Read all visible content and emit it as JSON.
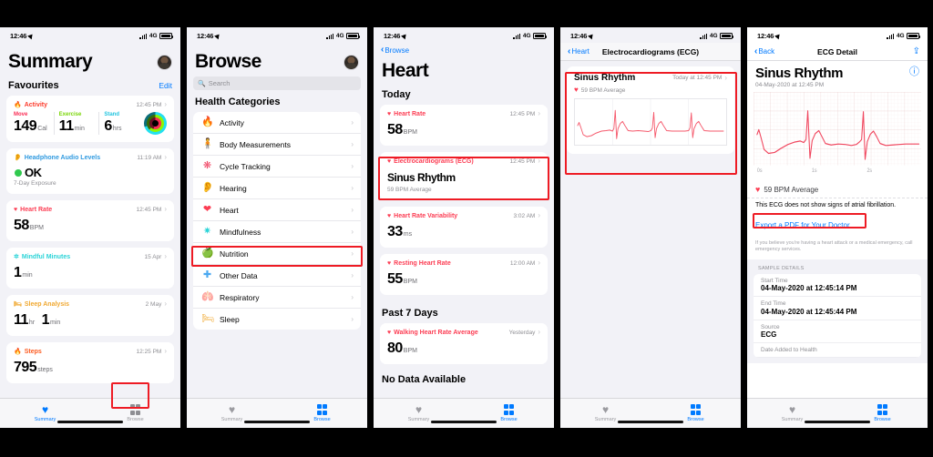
{
  "statusbar": {
    "time": "12:46",
    "network": "4G"
  },
  "panel1": {
    "title": "Summary",
    "section_label": "Favourites",
    "edit_label": "Edit",
    "cards": [
      {
        "name": "Activity",
        "icon": "flame-icon",
        "color": "#fc3c2d",
        "time": "12:45 PM",
        "rings": [
          {
            "label": "Move",
            "value": "149",
            "unit": "Cal",
            "color": "#fa2d55"
          },
          {
            "label": "Exercise",
            "value": "11",
            "unit": "min",
            "color": "#8ef501"
          },
          {
            "label": "Stand",
            "value": "6",
            "unit": "hrs",
            "color": "#22e0f0"
          }
        ]
      },
      {
        "name": "Headphone Audio Levels",
        "icon": "ear-icon",
        "color": "#2f9ae0",
        "time": "11:19 AM",
        "status": "OK",
        "sub": "7-Day Exposure"
      },
      {
        "name": "Heart Rate",
        "icon": "heart-icon",
        "color": "#fc3d53",
        "time": "12:45 PM",
        "value": "58",
        "unit": "BPM"
      },
      {
        "name": "Mindful Minutes",
        "icon": "mindfulness-icon",
        "color": "#2cd4d8",
        "time": "15 Apr",
        "value": "1",
        "unit": "min"
      },
      {
        "name": "Sleep Analysis",
        "icon": "bed-icon",
        "color": "#f0a830",
        "time": "2 May",
        "value": "11",
        "unit": "hr",
        "value2": "1",
        "unit2": "min"
      },
      {
        "name": "Steps",
        "icon": "flame-icon",
        "color": "#fc5b20",
        "time": "12:25 PM",
        "value": "795",
        "unit": "steps"
      }
    ]
  },
  "panel2": {
    "title": "Browse",
    "search_placeholder": "Search",
    "section_label": "Health Categories",
    "categories": [
      {
        "label": "Activity",
        "icon": "flame-icon",
        "glyph": "🔥"
      },
      {
        "label": "Body Measurements",
        "icon": "body-icon",
        "glyph": "🧍"
      },
      {
        "label": "Cycle Tracking",
        "icon": "cycle-icon",
        "glyph": "❋"
      },
      {
        "label": "Hearing",
        "icon": "ear-icon",
        "glyph": "👂"
      },
      {
        "label": "Heart",
        "icon": "heart-icon",
        "glyph": "❤"
      },
      {
        "label": "Mindfulness",
        "icon": "mindfulness-icon",
        "glyph": "✻"
      },
      {
        "label": "Nutrition",
        "icon": "apple-icon",
        "glyph": "🍏"
      },
      {
        "label": "Other Data",
        "icon": "cross-icon",
        "glyph": "✚"
      },
      {
        "label": "Respiratory",
        "icon": "lungs-icon",
        "glyph": "🫁"
      },
      {
        "label": "Sleep",
        "icon": "bed-icon",
        "glyph": "🛏"
      }
    ]
  },
  "panel3": {
    "back_label": "Browse",
    "title": "Heart",
    "section_today": "Today",
    "section_past7": "Past 7 Days",
    "section_nodata": "No Data Available",
    "today_cards": [
      {
        "name": "Heart Rate",
        "time": "12:45 PM",
        "value": "58",
        "unit": "BPM"
      },
      {
        "name": "Electrocardiograms (ECG)",
        "time": "12:45 PM",
        "value": "Sinus Rhythm",
        "sub": "59 BPM Average"
      },
      {
        "name": "Heart Rate Variability",
        "time": "3:02 AM",
        "value": "33",
        "unit": "ms"
      },
      {
        "name": "Resting Heart Rate",
        "time": "12:00 AM",
        "value": "55",
        "unit": "BPM"
      }
    ],
    "past7_cards": [
      {
        "name": "Walking Heart Rate Average",
        "time": "Yesterday",
        "value": "80",
        "unit": "BPM"
      }
    ]
  },
  "panel4": {
    "back_label": "Heart",
    "title": "Electrocardiograms (ECG)",
    "card": {
      "title": "Sinus Rhythm",
      "time": "Today at 12:45 PM",
      "average": "59 BPM Average"
    }
  },
  "panel5": {
    "back_label": "Back",
    "title": "ECG Detail",
    "share_icon": "share-icon",
    "result_title": "Sinus Rhythm",
    "result_date": "04-May-2020 at 12:45 PM",
    "info_icon": "info-icon",
    "axis_ticks": [
      "0s",
      "1s",
      "2s"
    ],
    "average": "59 BPM Average",
    "conclusion": "This ECG does not show signs of atrial fibrillation.",
    "export_label": "Export a PDF for Your Doctor",
    "disclaimer": "If you believe you're having a heart attack or a medical emergency, call emergency services.",
    "sample_details_header": "SAMPLE DETAILS",
    "details": [
      {
        "key": "Start Time",
        "value": "04-May-2020 at 12:45:14 PM"
      },
      {
        "key": "End Time",
        "value": "04-May-2020 at 12:45:44 PM"
      },
      {
        "key": "Source",
        "value": "ECG"
      },
      {
        "key": "Date Added to Health",
        "value": ""
      }
    ]
  },
  "tabbar": {
    "summary": "Summary",
    "browse": "Browse"
  },
  "colors": {
    "accent": "#007aff",
    "heart": "#fc3d53",
    "annotation": "#ee1b24"
  }
}
